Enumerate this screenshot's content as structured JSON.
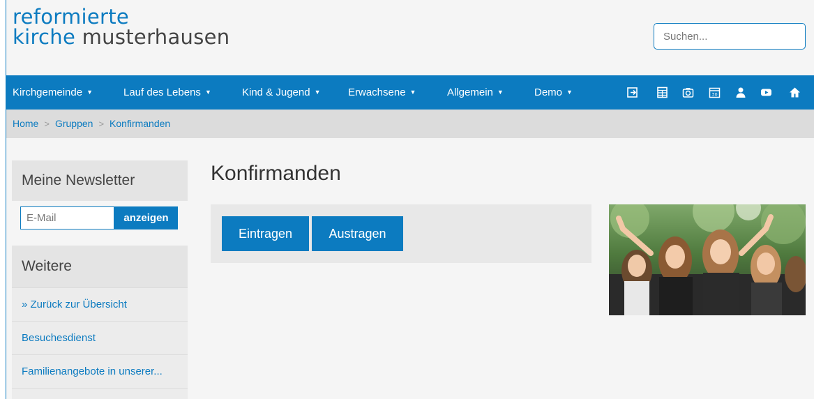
{
  "logo": {
    "line1": "reformierte",
    "line2_bold": "kirche",
    "line2_light": " musterhausen"
  },
  "search": {
    "placeholder": "Suchen..."
  },
  "nav": {
    "items": [
      {
        "label": "Kirchgemeinde"
      },
      {
        "label": "Lauf des Lebens"
      },
      {
        "label": "Kind & Jugend"
      },
      {
        "label": "Erwachsene"
      },
      {
        "label": "Allgemein"
      },
      {
        "label": "Demo"
      }
    ],
    "icons": [
      "login-icon",
      "table-icon",
      "camera-icon",
      "calendar-icon",
      "user-icon",
      "youtube-icon",
      "home-icon"
    ]
  },
  "breadcrumb": {
    "home": "Home",
    "level1": "Gruppen",
    "level2": "Konfirmanden",
    "separator": ">"
  },
  "sidebar": {
    "newsletter_title": "Meine Newsletter",
    "email_placeholder": "E-Mail",
    "show_button": "anzeigen",
    "more_title": "Weitere",
    "links": [
      {
        "label": "» Zurück zur Übersicht"
      },
      {
        "label": "Besuchesdienst"
      },
      {
        "label": "Familienangebote in unserer..."
      }
    ]
  },
  "main": {
    "title": "Konfirmanden",
    "subscribe_button": "Eintragen",
    "unsubscribe_button": "Austragen"
  },
  "colors": {
    "accent": "#0c7bc0",
    "breadcrumb_bg": "#dcdcdc",
    "panel_bg": "#e8e8e8"
  }
}
